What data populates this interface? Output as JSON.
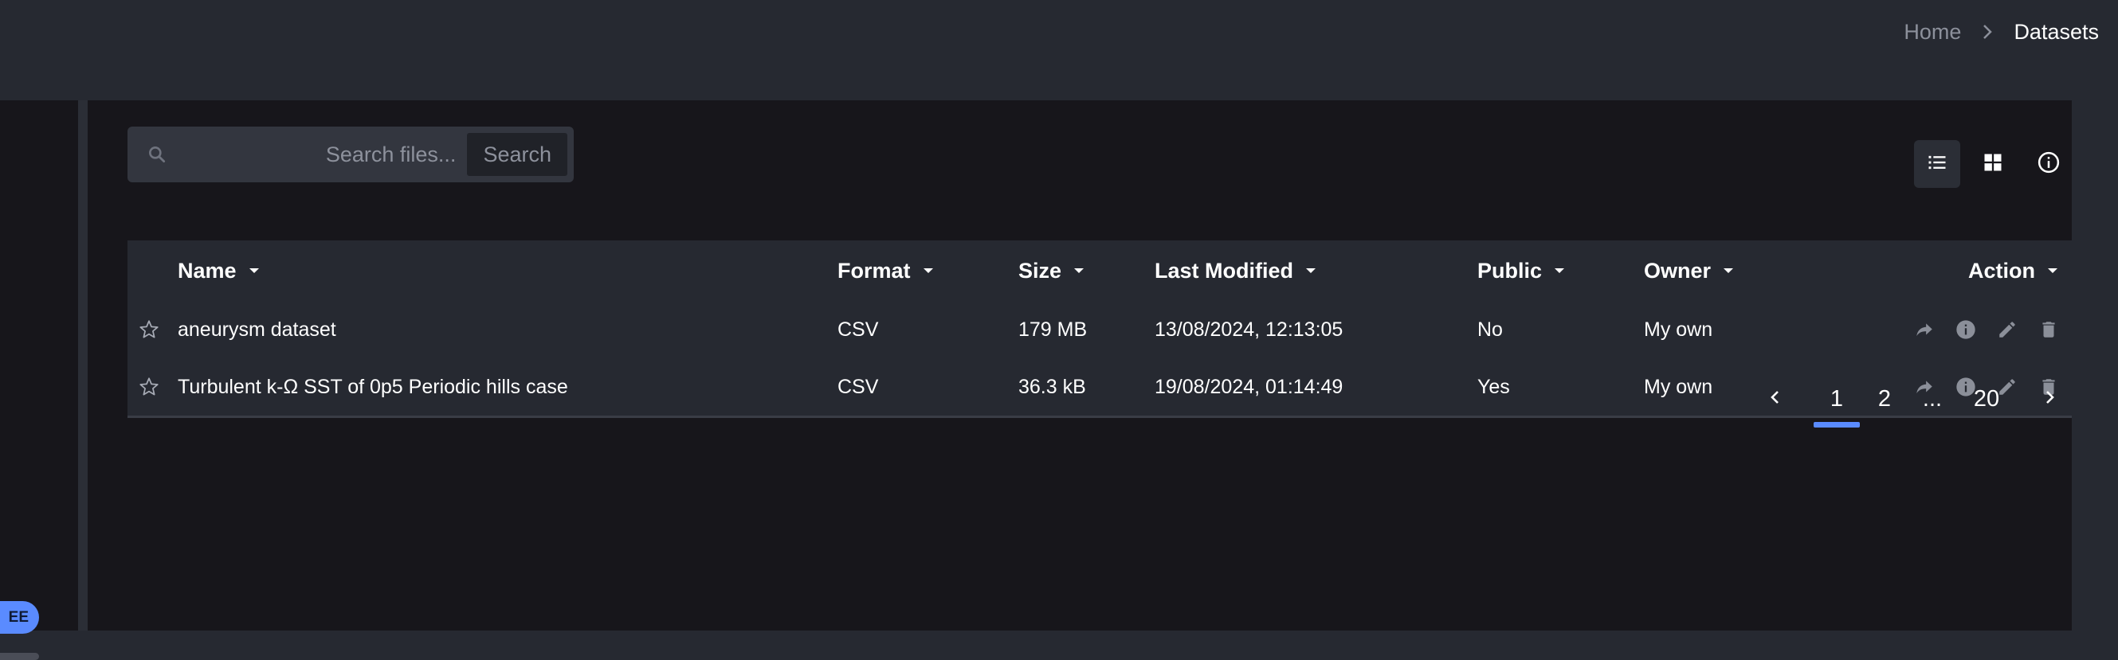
{
  "breadcrumb": {
    "home": "Home",
    "current": "Datasets"
  },
  "sidebar": {
    "badge_label": "EE",
    "usage_fraction": 0.5
  },
  "search": {
    "placeholder": "Search files...",
    "value": "",
    "button_label": "Search"
  },
  "view_toggle": {
    "list_icon": "list-view-icon",
    "grid_icon": "grid-view-icon",
    "info_icon": "info-icon",
    "active": "list"
  },
  "table": {
    "headers": {
      "name": "Name",
      "format": "Format",
      "size": "Size",
      "last_modified": "Last Modified",
      "public": "Public",
      "owner": "Owner",
      "action": "Action"
    },
    "rows": [
      {
        "name": "aneurysm dataset",
        "format": "CSV",
        "size": "179 MB",
        "last_modified": "13/08/2024, 12:13:05",
        "public": "No",
        "owner": "My own"
      },
      {
        "name": "Turbulent k-Ω SST of 0p5 Periodic hills case",
        "format": "CSV",
        "size": "36.3 kB",
        "last_modified": "19/08/2024, 01:14:49",
        "public": "Yes",
        "owner": "My own"
      }
    ],
    "row_actions": [
      "share-icon",
      "info-icon",
      "edit-icon",
      "delete-icon"
    ]
  },
  "pagination": {
    "pages": [
      "1",
      "2",
      "...",
      "20"
    ],
    "current": "1"
  },
  "colors": {
    "accent": "#5a8bff",
    "background": "#262931",
    "panel": "#17161b"
  }
}
